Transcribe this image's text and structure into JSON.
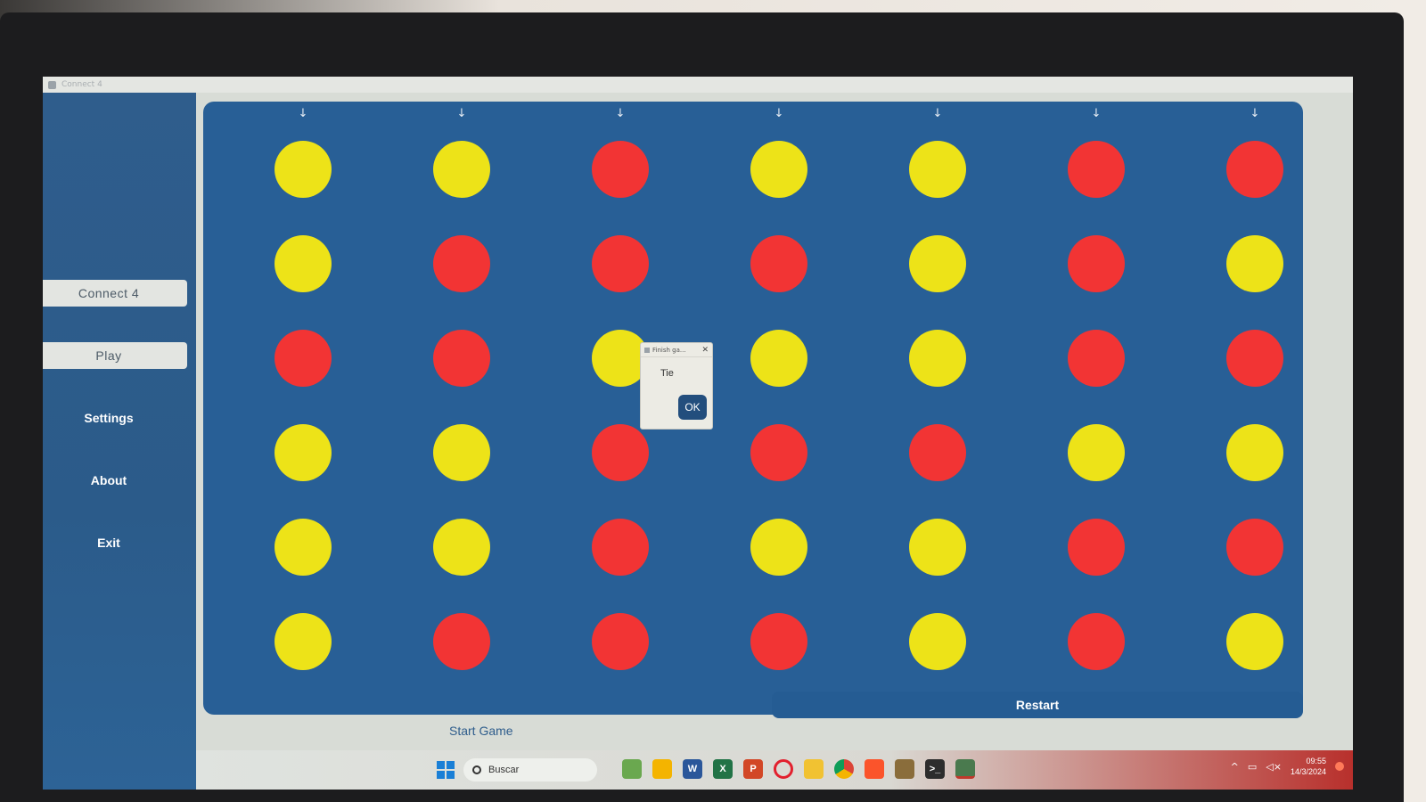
{
  "window": {
    "title": "Connect 4"
  },
  "sidebar": {
    "items": [
      {
        "label": "Connect 4"
      },
      {
        "label": "Play"
      },
      {
        "label": "Settings"
      },
      {
        "label": "About"
      },
      {
        "label": "Exit"
      }
    ]
  },
  "board": {
    "columns": 7,
    "rows": 6,
    "drop_arrow": "↓",
    "colors": {
      "red": "#f23434",
      "yellow": "#ede318",
      "board": "#285f96"
    },
    "grid": [
      [
        "yellow",
        "yellow",
        "red",
        "yellow",
        "yellow",
        "red",
        "red"
      ],
      [
        "yellow",
        "red",
        "red",
        "red",
        "yellow",
        "red",
        "yellow"
      ],
      [
        "red",
        "red",
        "yellow",
        "yellow",
        "yellow",
        "red",
        "red"
      ],
      [
        "yellow",
        "yellow",
        "red",
        "red",
        "red",
        "yellow",
        "yellow"
      ],
      [
        "yellow",
        "yellow",
        "red",
        "yellow",
        "yellow",
        "red",
        "red"
      ],
      [
        "yellow",
        "red",
        "red",
        "red",
        "yellow",
        "red",
        "yellow"
      ]
    ]
  },
  "dialog": {
    "title": "Finish ga...",
    "message": "Tie",
    "ok_label": "OK",
    "close_glyph": "✕"
  },
  "controls": {
    "start_label": "Start Game",
    "restart_label": "Restart"
  },
  "taskbar": {
    "search_placeholder": "Buscar",
    "time": "09:55",
    "date": "14/3/2024",
    "apps": [
      "widgets-icon",
      "file-explorer-icon",
      "word-icon",
      "excel-icon",
      "powerpoint-icon",
      "opera-icon",
      "notes-icon",
      "chrome-icon",
      "brave-icon",
      "app-icon",
      "terminal-icon",
      "connect4-app-icon"
    ]
  }
}
